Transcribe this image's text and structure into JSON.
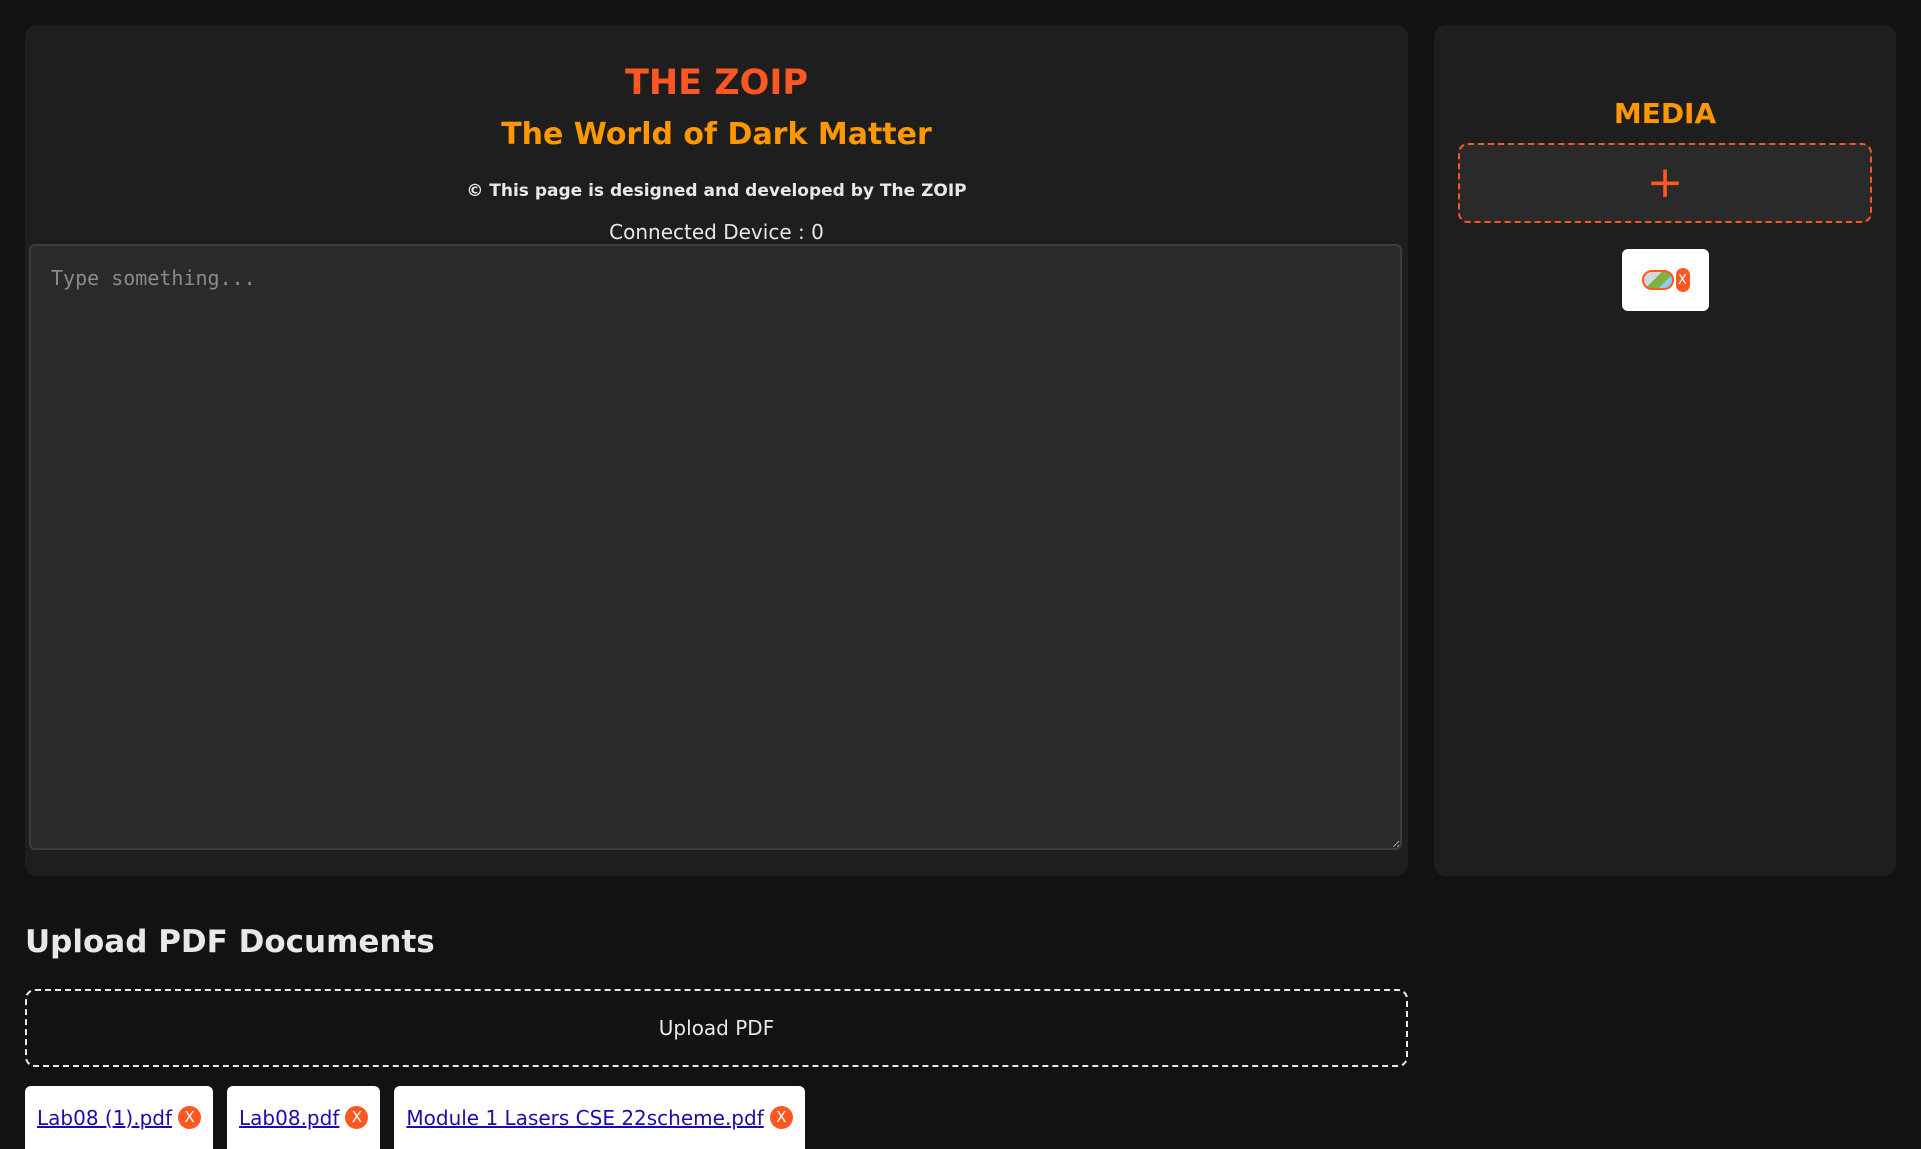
{
  "header": {
    "title": "THE ZOIP",
    "subtitle": "The World of Dark Matter",
    "credit": "© This page is designed and developed by The ZOIP",
    "connected_devices": "Connected Device : 0"
  },
  "editor": {
    "value": "",
    "placeholder": "Type something..."
  },
  "media": {
    "title": "MEDIA",
    "add_icon": "plus-icon",
    "add_glyph": "+",
    "items": [
      {
        "icon": "broken-image-icon",
        "remove_label": "X"
      }
    ]
  },
  "upload": {
    "heading": "Upload PDF Documents",
    "button_label": "Upload PDF",
    "files": [
      {
        "name": "Lab08 (1).pdf",
        "remove_label": "X"
      },
      {
        "name": "Lab08.pdf",
        "remove_label": "X"
      },
      {
        "name": "Module 1 Lasers CSE 22scheme.pdf",
        "remove_label": "X"
      }
    ]
  },
  "colors": {
    "background": "#121212",
    "panel": "#1e1e1e",
    "accent_primary": "#ff5722",
    "accent_secondary": "#ff9800",
    "link": "#1a0dab"
  }
}
